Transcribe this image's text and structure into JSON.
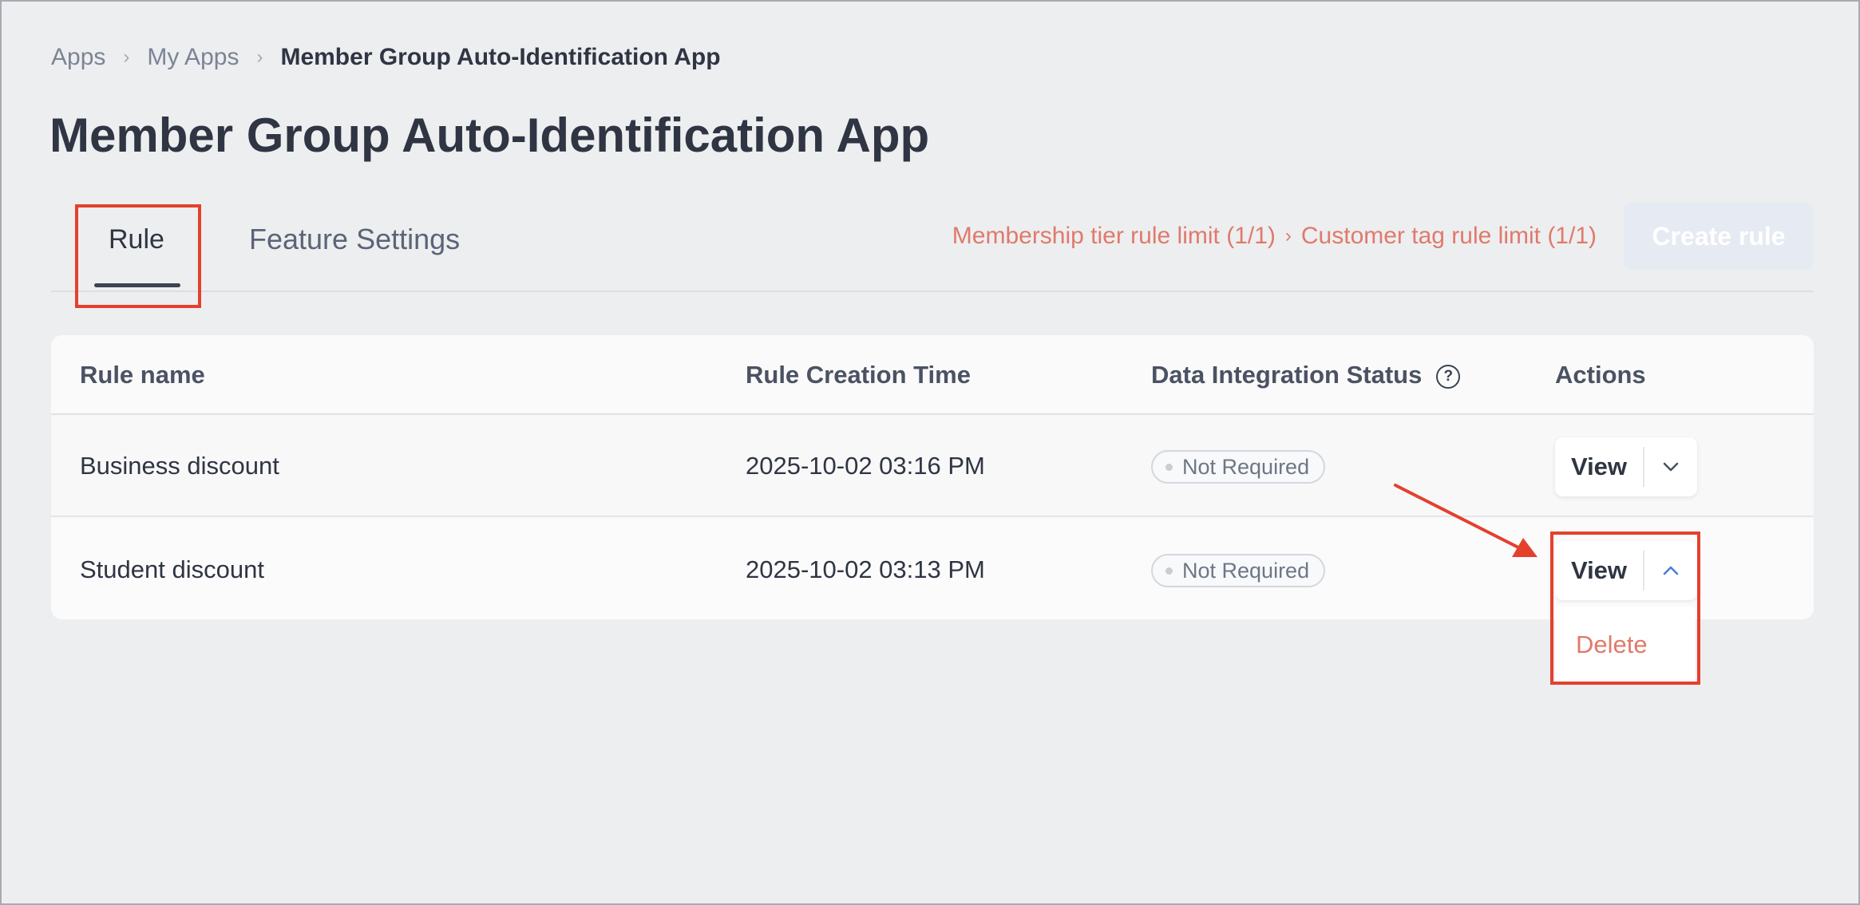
{
  "breadcrumb": {
    "items": [
      "Apps",
      "My Apps"
    ],
    "current": "Member Group Auto-Identification App"
  },
  "page": {
    "title": "Member Group Auto-Identification App"
  },
  "tabs": [
    {
      "label": "Rule",
      "active": true
    },
    {
      "label": "Feature Settings",
      "active": false
    }
  ],
  "limits": {
    "membership": "Membership tier rule limit (1/1)",
    "customer_tag": "Customer tag rule limit (1/1)"
  },
  "create_button": {
    "label": "Create rule",
    "disabled": true
  },
  "table": {
    "columns": [
      "Rule name",
      "Rule Creation Time",
      "Data Integration Status",
      "Actions"
    ],
    "help_icon_glyph": "?",
    "rows": [
      {
        "name": "Business discount",
        "created": "2025-10-02 03:16 PM",
        "status": "Not Required",
        "action": "View"
      },
      {
        "name": "Student discount",
        "created": "2025-10-02 03:13 PM",
        "status": "Not Required",
        "action": "View"
      }
    ]
  },
  "dropdown": {
    "items": [
      "Delete"
    ]
  },
  "colors": {
    "annotation": "#e3412d",
    "limit_text": "#e07a6b",
    "chevron_active": "#4a7fd4"
  },
  "icons": {
    "breadcrumb_separator": "chevron-right-icon",
    "help": "question-circle-icon",
    "row1_toggle": "chevron-down-icon",
    "row2_toggle": "chevron-up-icon",
    "annotation_arrow": "arrow-icon"
  }
}
